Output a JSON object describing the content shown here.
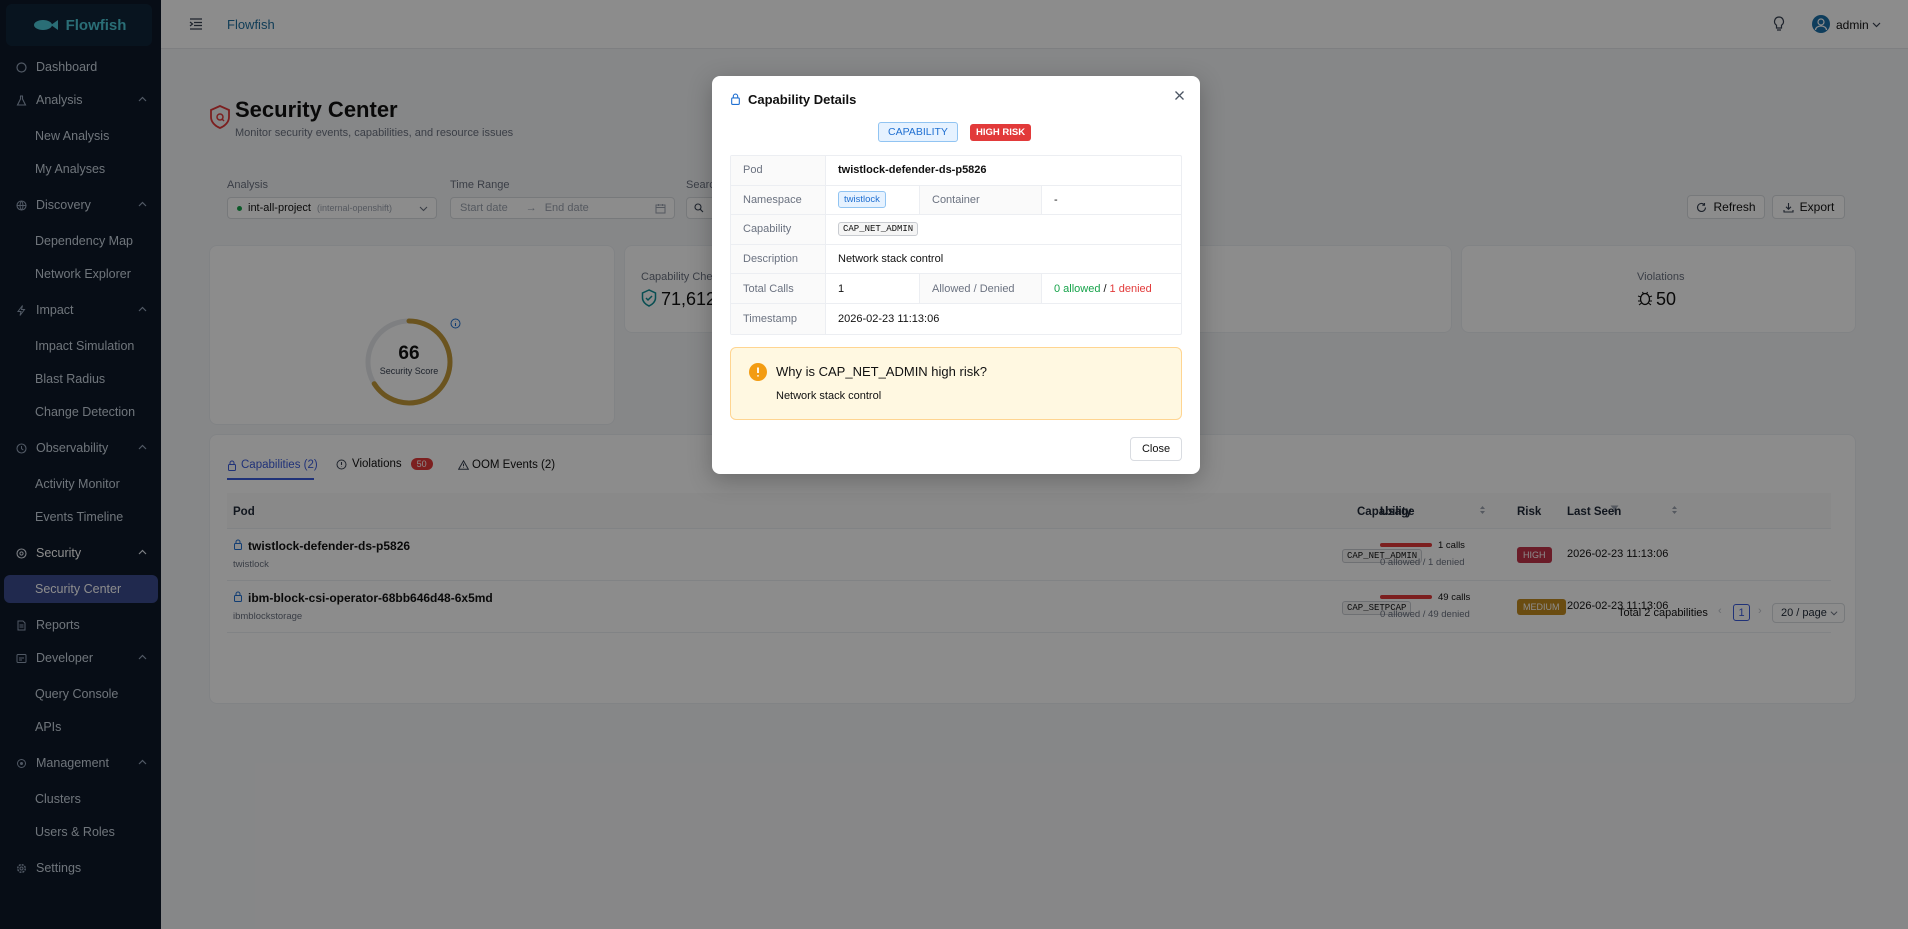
{
  "app": {
    "name": "Flowfish",
    "title": "Flowfish",
    "user": "admin"
  },
  "sidebar": {
    "dashboard": "Dashboard",
    "analysis": {
      "label": "Analysis",
      "items": [
        "New Analysis",
        "My Analyses"
      ]
    },
    "discovery": {
      "label": "Discovery",
      "items": [
        "Dependency Map",
        "Network Explorer"
      ]
    },
    "impact": {
      "label": "Impact",
      "items": [
        "Impact Simulation",
        "Blast Radius",
        "Change Detection"
      ]
    },
    "observability": {
      "label": "Observability",
      "items": [
        "Activity Monitor",
        "Events Timeline"
      ]
    },
    "security": {
      "label": "Security",
      "items": [
        "Security Center"
      ]
    },
    "reports": "Reports",
    "developer": {
      "label": "Developer",
      "items": [
        "Query Console",
        "APIs"
      ]
    },
    "management": {
      "label": "Management",
      "items": [
        "Clusters",
        "Users & Roles"
      ]
    },
    "settings": "Settings"
  },
  "page": {
    "title": "Security Center",
    "subtitle": "Monitor security events, capabilities, and resource issues"
  },
  "filters": {
    "analysis_label": "Analysis",
    "analysis_value": "int-all-project",
    "analysis_hint": "(internal-openshift)",
    "time_label": "Time Range",
    "start_placeholder": "Start date",
    "end_placeholder": "End date",
    "search_label": "Searc"
  },
  "actions": {
    "refresh": "Refresh",
    "export": "Export"
  },
  "score": {
    "value": "66",
    "label": "Security Score",
    "progress": 0.66
  },
  "stats": {
    "capability_label": "Capability Che",
    "capability_value": "71,612",
    "violations_label": "Violations",
    "violations_value": "50"
  },
  "tabs": {
    "capabilities": "Capabilities (2)",
    "violations": "Violations",
    "violations_badge": "50",
    "oom": "OOM Events (2)"
  },
  "table": {
    "columns": {
      "pod": "Pod",
      "capability": "Capability",
      "usage": "Usage",
      "risk": "Risk",
      "last_seen": "Last Seen"
    },
    "rows": [
      {
        "pod": "twistlock-defender-ds-p5826",
        "namespace": "twistlock",
        "capability": "CAP_NET_ADMIN",
        "calls": "1 calls",
        "detail": "0 allowed / 1 denied",
        "risk": "HIGH",
        "last_seen": "2026-02-23 11:13:06"
      },
      {
        "pod": "ibm-block-csi-operator-68bb646d48-6x5md",
        "namespace": "ibmblockstorage",
        "capability": "CAP_SETPCAP",
        "calls": "49 calls",
        "detail": "0 allowed / 49 denied",
        "risk": "MEDIUM",
        "last_seen": "2026-02-23 11:13:06"
      }
    ],
    "total": "Total 2 capabilities",
    "page": "1",
    "page_size": "20 / page"
  },
  "modal": {
    "title": "Capability Details",
    "tag_capability": "CAPABILITY",
    "tag_risk": "HIGH RISK",
    "labels": {
      "pod": "Pod",
      "namespace": "Namespace",
      "container": "Container",
      "capability": "Capability",
      "description": "Description",
      "total_calls": "Total Calls",
      "allowed_denied": "Allowed / Denied",
      "timestamp": "Timestamp"
    },
    "values": {
      "pod": "twistlock-defender-ds-p5826",
      "namespace": "twistlock",
      "container": "-",
      "capability": "CAP_NET_ADMIN",
      "description": "Network stack control",
      "total_calls": "1",
      "allowed": "0 allowed",
      "sep": "/",
      "denied": "1 denied",
      "timestamp": "2026-02-23 11:13:06"
    },
    "alert": {
      "title": "Why is CAP_NET_ADMIN high risk?",
      "body": "Network stack control"
    },
    "close": "Close"
  }
}
